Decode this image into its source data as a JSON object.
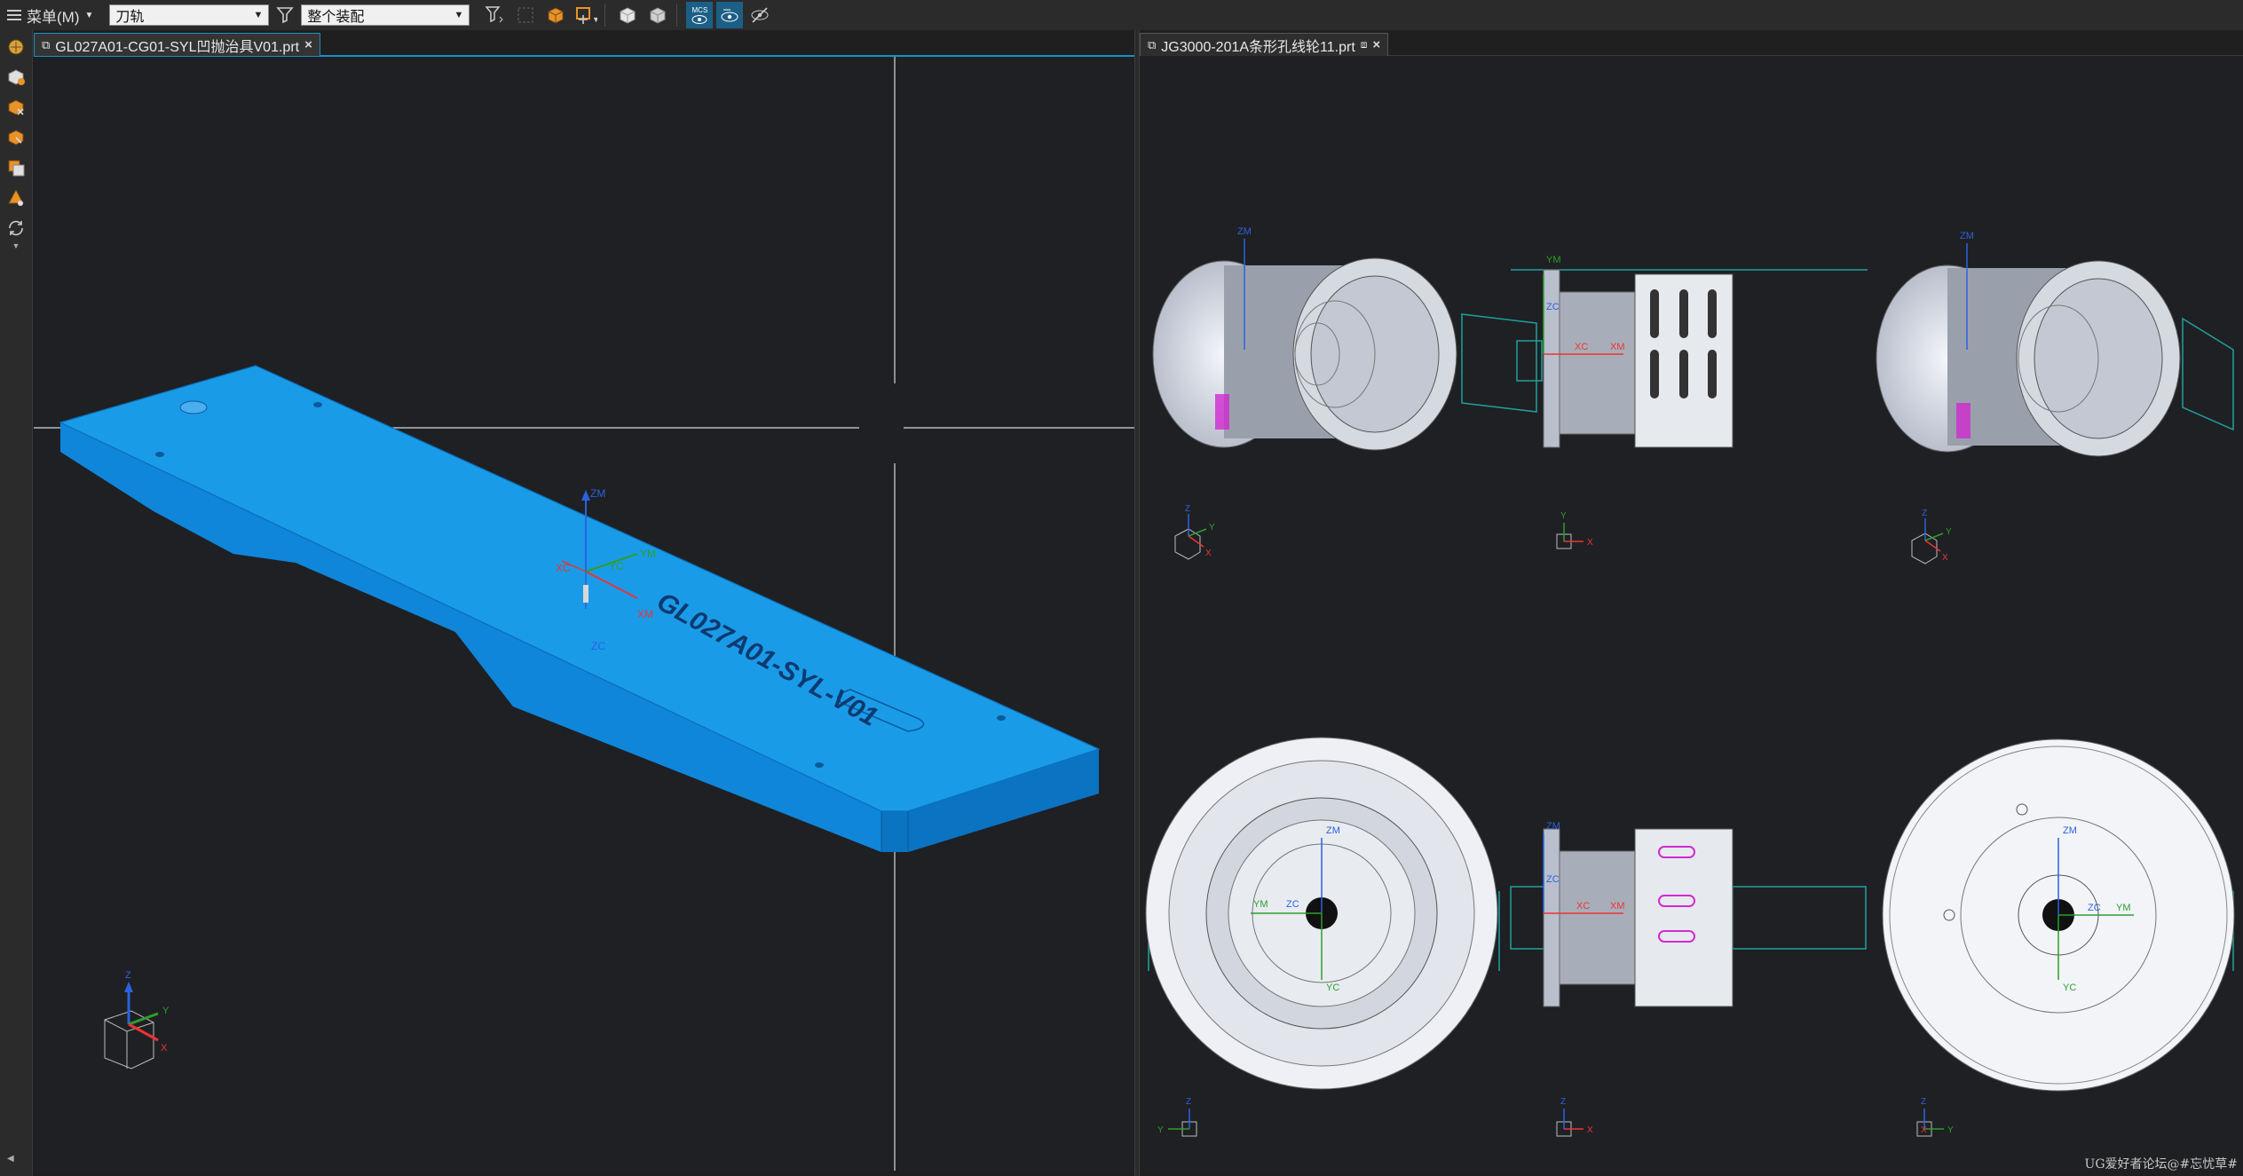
{
  "toolbar": {
    "menu_label": "菜单(M)",
    "filter_combo_value": "刀轨",
    "assembly_combo_value": "整个装配",
    "mcs_badge": "MCS"
  },
  "left_pane": {
    "tab_title": "GL027A01-CG01-SYL凹抛治具V01.prt",
    "part_engraving": "GL027A01-SYL-V01",
    "wcs": {
      "zm": "ZM",
      "xc": "XC",
      "yc": "YC",
      "ym": "YM",
      "xm": "XM",
      "zc": "ZC"
    },
    "triad": {
      "z": "Z",
      "y": "Y",
      "x": "X"
    }
  },
  "right_pane": {
    "tab_title": "JG3000-201A条形孔线轮11.prt",
    "views": [
      {
        "labels": [
          "ZM"
        ],
        "triad": [
          "Z",
          "Y",
          "X"
        ]
      },
      {
        "labels": [
          "YM",
          "ZC",
          "XC",
          "XM"
        ],
        "triad": [
          "Y",
          "X"
        ]
      },
      {
        "labels": [
          "ZM"
        ],
        "triad": [
          "Z",
          "Y",
          "X"
        ]
      },
      {
        "labels": [
          "ZM",
          "YM",
          "ZC",
          "YC"
        ],
        "triad": [
          "Z",
          "Y"
        ]
      },
      {
        "labels": [
          "ZM",
          "ZC",
          "XC",
          "XM"
        ],
        "triad": [
          "Z",
          "X"
        ]
      },
      {
        "labels": [
          "ZM",
          "ZC",
          "YM",
          "YC"
        ],
        "triad": [
          "Z",
          "X",
          "Y"
        ]
      }
    ]
  },
  "watermark": "UG爱好者论坛@#忘忧草#",
  "colors": {
    "part_blue": "#1a9be8",
    "viewport_bg": "#1f2023",
    "accent": "#1a8fc4"
  }
}
